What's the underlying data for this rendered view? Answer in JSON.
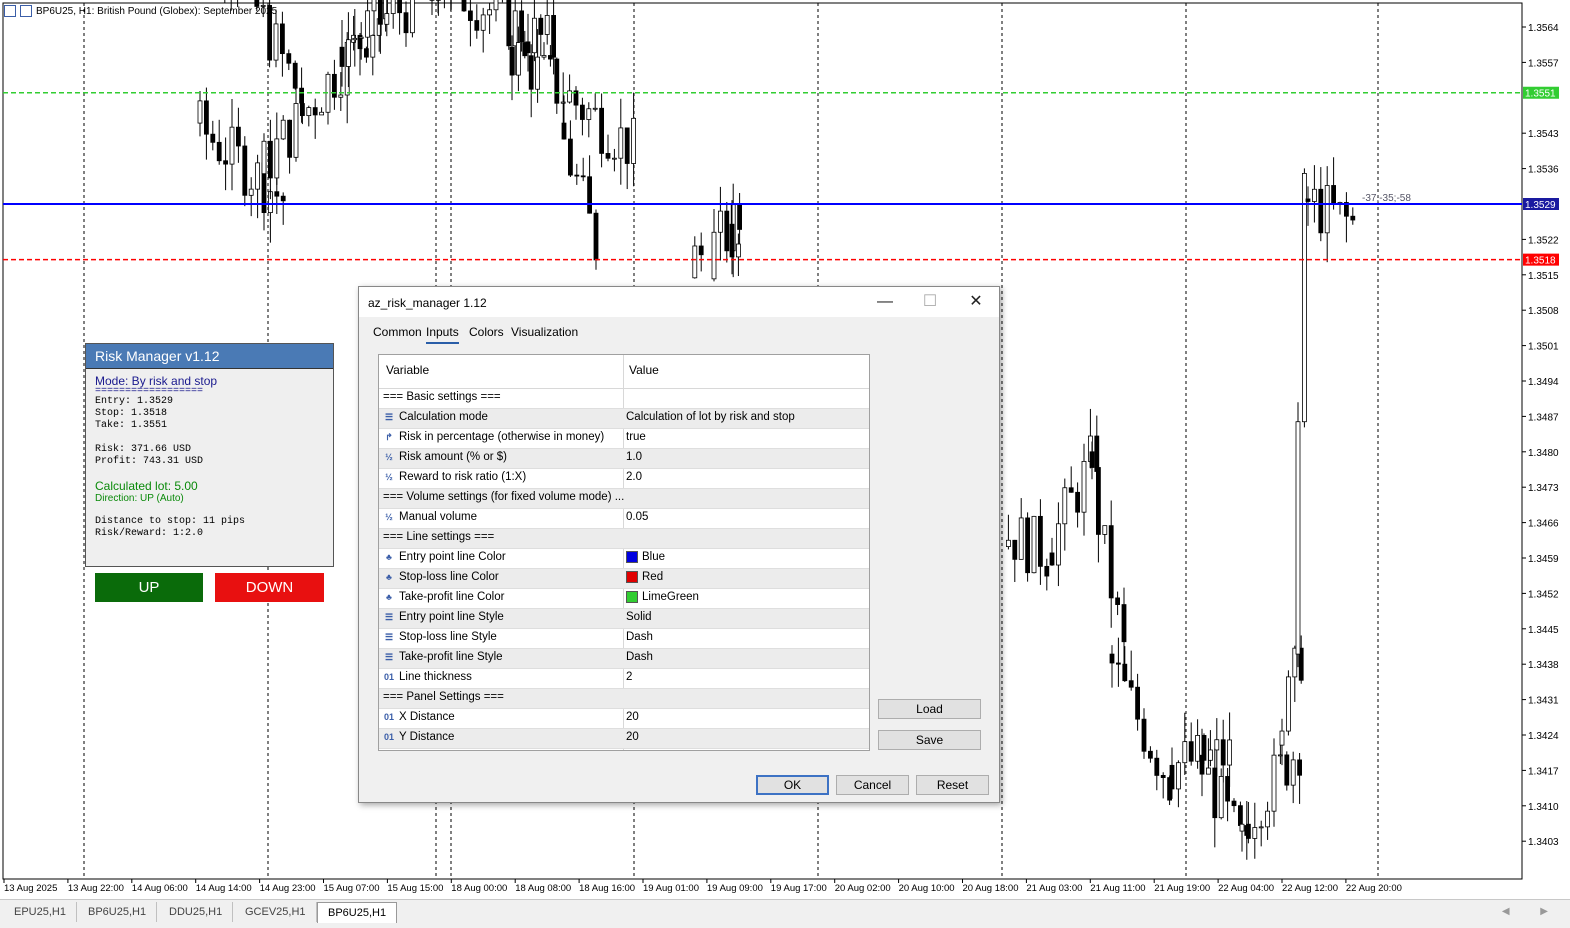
{
  "chart": {
    "symbol_title": "BP6U25, H1:  British Pound (Globex): September 2025",
    "price_labels": [
      "1.3564",
      "1.3557",
      "1.3543",
      "1.3536",
      "1.3522",
      "1.3515",
      "1.3508",
      "1.3501",
      "1.3494",
      "1.3487",
      "1.3480",
      "1.3473",
      "1.3466",
      "1.3459",
      "1.3452",
      "1.3445",
      "1.3438",
      "1.3431",
      "1.3424",
      "1.3417",
      "1.3410",
      "1.3403"
    ],
    "time_labels": [
      "13 Aug 2025",
      "13 Aug 22:00",
      "14 Aug 06:00",
      "14 Aug 14:00",
      "14 Aug 23:00",
      "15 Aug 07:00",
      "15 Aug 15:00",
      "18 Aug 00:00",
      "18 Aug 08:00",
      "18 Aug 16:00",
      "19 Aug 01:00",
      "19 Aug 09:00",
      "19 Aug 17:00",
      "20 Aug 02:00",
      "20 Aug 10:00",
      "20 Aug 18:00",
      "21 Aug 03:00",
      "21 Aug 11:00",
      "21 Aug 19:00",
      "22 Aug 04:00",
      "22 Aug 12:00",
      "22 Aug 20:00"
    ],
    "take_profit_price": "1.3551",
    "entry_price": "1.3529",
    "stop_price": "1.3518",
    "line_annotation": "-37;-35;-58",
    "colors": {
      "take_profit": "#32cd32",
      "entry": "#0000ff",
      "stop": "#ff0000"
    }
  },
  "risk_panel": {
    "title": "Risk Manager v1.12",
    "mode": "Mode: By risk and stop",
    "separator": "==================",
    "entry": "Entry: 1.3529",
    "stop": "Stop: 1.3518",
    "take": "Take: 1.3551",
    "risk": "Risk: 371.66 USD",
    "profit": "Profit: 743.31 USD",
    "lot": "Calculated lot: 5.00",
    "direction": "Direction: UP (Auto)",
    "distance": "Distance to stop: 11 pips",
    "rr": "Risk/Reward: 1:2.0",
    "up_label": "UP",
    "down_label": "DOWN"
  },
  "dialog": {
    "title": "az_risk_manager 1.12",
    "minimize": "—",
    "maximize": "☐",
    "close": "✕",
    "tabs": [
      "Common",
      "Inputs",
      "Colors",
      "Visualization"
    ],
    "col_variable": "Variable",
    "col_value": "Value",
    "rows": [
      {
        "icon": "",
        "name": "=== Basic settings ===",
        "value": ""
      },
      {
        "icon": "enum",
        "name": "Calculation mode",
        "value": "Calculation of lot by risk and stop"
      },
      {
        "icon": "bool",
        "name": "Risk in percentage (otherwise in money)",
        "value": "true"
      },
      {
        "icon": "double",
        "name": "Risk amount (% or $)",
        "value": "1.0"
      },
      {
        "icon": "double",
        "name": "Reward to risk ratio (1:X)",
        "value": "2.0"
      },
      {
        "icon": "",
        "name": "=== Volume settings (for fixed volume mode) ...",
        "value": ""
      },
      {
        "icon": "double",
        "name": "Manual volume",
        "value": "0.05"
      },
      {
        "icon": "",
        "name": "=== Line settings ===",
        "value": ""
      },
      {
        "icon": "color",
        "name": "Entry point line Color",
        "value": "Blue",
        "swatch": "#0000e0"
      },
      {
        "icon": "color",
        "name": "Stop-loss line Color",
        "value": "Red",
        "swatch": "#e00000"
      },
      {
        "icon": "color",
        "name": "Take-profit line Color",
        "value": "LimeGreen",
        "swatch": "#32cd32"
      },
      {
        "icon": "enum",
        "name": "Entry point line Style",
        "value": "Solid"
      },
      {
        "icon": "enum",
        "name": "Stop-loss line Style",
        "value": "Dash"
      },
      {
        "icon": "enum",
        "name": "Take-profit line Style",
        "value": "Dash"
      },
      {
        "icon": "int",
        "name": "Line thickness",
        "value": "2"
      },
      {
        "icon": "",
        "name": "=== Panel Settings ===",
        "value": ""
      },
      {
        "icon": "int",
        "name": "X Distance",
        "value": "20"
      },
      {
        "icon": "int",
        "name": "Y Distance",
        "value": "20"
      }
    ],
    "load": "Load",
    "save": "Save",
    "ok": "OK",
    "cancel": "Cancel",
    "reset": "Reset"
  },
  "symbol_tabs": [
    "EPU25,H1",
    "BP6U25,H1",
    "DDU25,H1",
    "GCEV25,H1",
    "BP6U25,H1"
  ]
}
